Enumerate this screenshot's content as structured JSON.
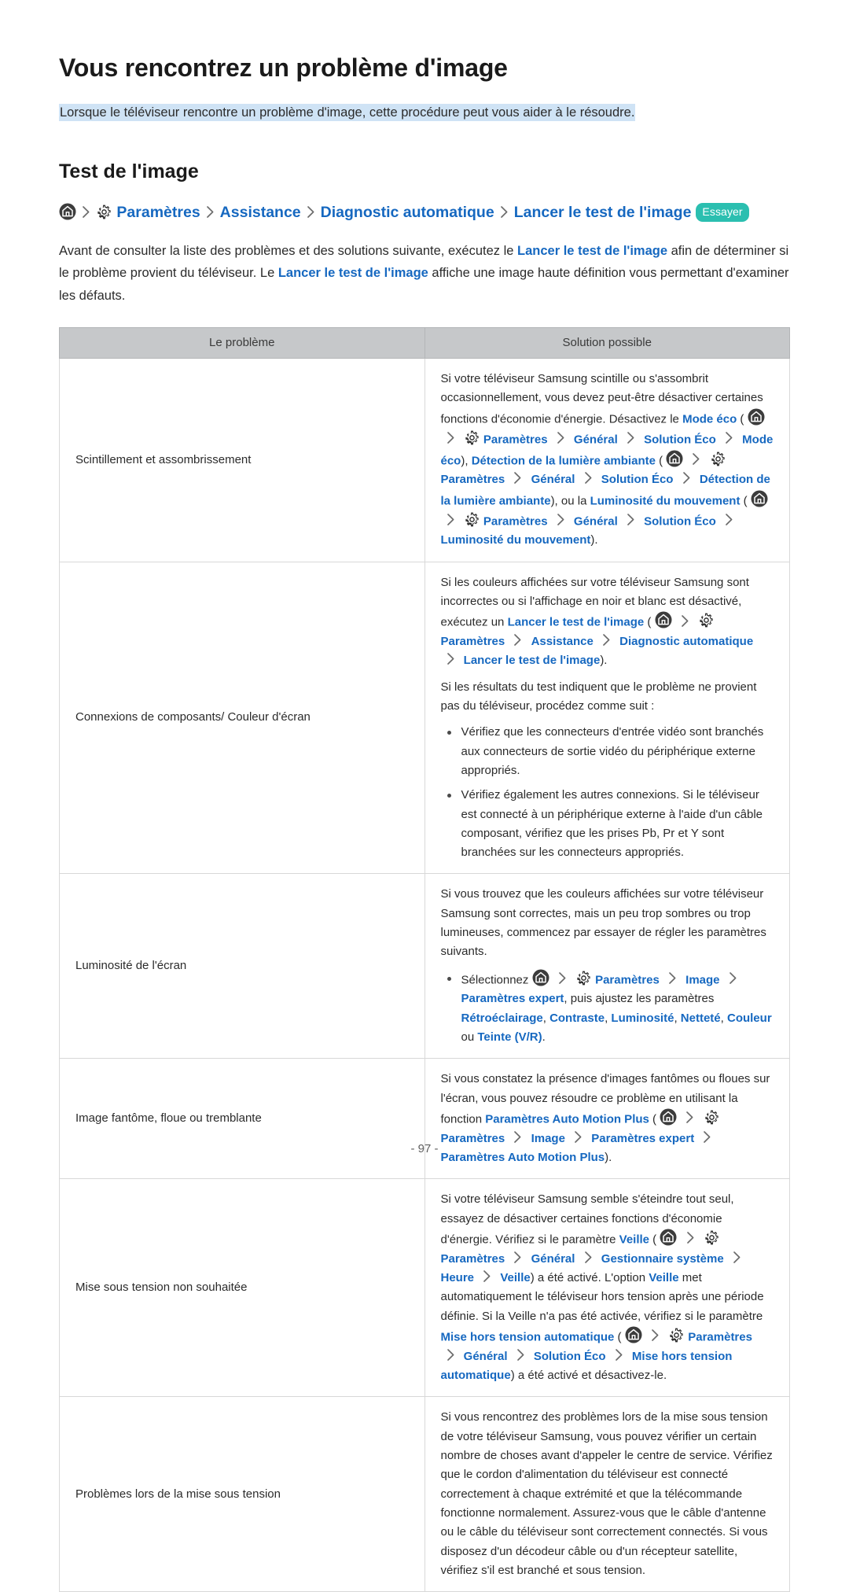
{
  "document": {
    "title": "Vous rencontrez un problème d'image",
    "lead": "Lorsque le téléviseur rencontre un problème d'image, cette procédure peut vous aider à le résoudre.",
    "section_title": "Test de l'image",
    "page_number": "- 97 -"
  },
  "colors": {
    "link": "#1668c0",
    "highlight": "#cfe3f5",
    "badge": "#2bbfb0",
    "table_header_bg": "#c6c8ca",
    "text": "#2b2b2b"
  },
  "path": {
    "home_icon": "home-icon",
    "gear_icon": "gear-icon",
    "chevron_icon": "chevron-right-icon",
    "items": [
      "Paramètres",
      "Assistance",
      "Diagnostic automatique",
      "Lancer le test de l'image"
    ],
    "badge_label": "Essayer"
  },
  "intro": {
    "part1": "Avant de consulter la liste des problèmes et des solutions suivante, exécutez le ",
    "link1": "Lancer le test de l'image",
    "part2": " afin de déterminer si le problème provient du téléviseur. Le ",
    "link2": "Lancer le test de l'image",
    "part3": " affiche une image haute définition vous permettant d'examiner les défauts."
  },
  "table": {
    "headers": {
      "problem": "Le problème",
      "solution": "Solution possible"
    },
    "rows": [
      {
        "problem": "Scintillement et assombrissement",
        "p1_a": "Si votre téléviseur Samsung scintille ou s'assombrit occasionnellement, vous devez peut-être désactiver certaines fonctions d'économie d'énergie. Désactivez le ",
        "p1_link_mode_eco": "Mode éco",
        "p1_open": " (",
        "p1_settings": "Paramètres",
        "p1_general": "Général",
        "p1_solution_eco": "Solution Éco",
        "p1_mode_eco2": "Mode éco",
        "p1_close_comma": "), ",
        "p1_link_detection": "Détection de la lumière ambiante",
        "p1_open2": " (",
        "p1_settings2": "Paramètres",
        "p1_general2": "Général",
        "p1_solution_eco2": "Solution Éco",
        "p1_detection2": "Détection de la lumière ambiante",
        "p1_close_comma2": "), ou la ",
        "p1_link_lumi": "Luminosité du mouvement",
        "p1_open3": " (",
        "p1_settings3": "Paramètres",
        "p1_general3": "Général",
        "p1_solution_eco3": "Solution Éco",
        "p1_lumi2": "Luminosité du mouvement",
        "p1_end": ")."
      },
      {
        "problem": "Connexions de composants/ Couleur d'écran",
        "p1_a": "Si les couleurs affichées sur votre téléviseur Samsung sont incorrectes ou si l'affichage en noir et blanc est désactivé, exécutez un ",
        "p1_link_test": "Lancer le test de l'image",
        "p1_open": " (",
        "p1_settings": "Paramètres",
        "p1_assistance": "Assistance",
        "p1_diag": "Diagnostic automatique",
        "p1_test2": "Lancer le test de l'image",
        "p1_end": ").",
        "p2": "Si les résultats du test indiquent que le problème ne provient pas du téléviseur, procédez comme suit :",
        "bullets": [
          "Vérifiez que les connecteurs d'entrée vidéo sont branchés aux connecteurs de sortie vidéo du périphérique externe appropriés.",
          "Vérifiez également les autres connexions. Si le téléviseur est connecté à un périphérique externe à l'aide d'un câble composant, vérifiez que les prises Pb, Pr et Y sont branchées sur les connecteurs appropriés."
        ]
      },
      {
        "problem": "Luminosité de l'écran",
        "p1": "Si vous trouvez que les couleurs affichées sur votre téléviseur Samsung sont correctes, mais un peu trop sombres ou trop lumineuses, commencez par essayer de régler les paramètres suivants.",
        "b_select": "Sélectionnez ",
        "b_settings": "Paramètres",
        "b_image": "Image",
        "b_expert": "Paramètres expert",
        "b_mid": ", puis ajustez les paramètres ",
        "b_retro": "Rétroéclairage",
        "b_contraste": "Contraste",
        "b_luminosite": "Luminosité",
        "b_nettete": "Netteté",
        "b_couleur": "Couleur",
        "b_ou": " ou ",
        "b_teinte": "Teinte (V/R)",
        "b_end": "."
      },
      {
        "problem": "Image fantôme, floue ou tremblante",
        "p1_a": "Si vous constatez la présence d'images fantômes ou floues sur l'écran, vous pouvez résoudre ce problème en utilisant la fonction ",
        "p1_link_amp": "Paramètres Auto Motion Plus",
        "p1_open": " (",
        "p1_settings": "Paramètres",
        "p1_image": "Image",
        "p1_expert": "Paramètres expert",
        "p1_amp2": "Paramètres Auto Motion Plus",
        "p1_end": ")."
      },
      {
        "problem": "Mise sous tension non souhaitée",
        "p1_a": "Si votre téléviseur Samsung semble s'éteindre tout seul, essayez de désactiver certaines fonctions d'économie d'énergie. Vérifiez si le paramètre ",
        "p1_veille": "Veille",
        "p1_open": " (",
        "p1_settings": "Paramètres",
        "p1_general": "Général",
        "p1_gest": "Gestionnaire système",
        "p1_heure": "Heure",
        "p1_veille2": "Veille",
        "p1_mid": ") a été activé. L'option ",
        "p1_veille3": "Veille",
        "p1_mid2": " met automatiquement le téléviseur hors tension après une période définie. Si la Veille n'a pas été activée, vérifiez si le paramètre ",
        "p1_mhta": "Mise hors tension automatique",
        "p1_open2": " (",
        "p1_settings2": "Paramètres",
        "p1_general2": "Général",
        "p1_solution_eco": "Solution Éco",
        "p1_mhta2": "Mise hors tension automatique",
        "p1_end": ") a été activé et désactivez-le."
      },
      {
        "problem": "Problèmes lors de la mise sous tension",
        "p1": "Si vous rencontrez des problèmes lors de la mise sous tension de votre téléviseur Samsung, vous pouvez vérifier un certain nombre de choses avant d'appeler le centre de service. Vérifiez que le cordon d'alimentation du téléviseur est connecté correctement à chaque extrémité et que la télécommande fonctionne normalement. Assurez-vous que le câble d'antenne ou le câble du téléviseur sont correctement connectés. Si vous disposez d'un décodeur câble ou d'un récepteur satellite, vérifiez s'il est branché et sous tension."
      }
    ]
  }
}
